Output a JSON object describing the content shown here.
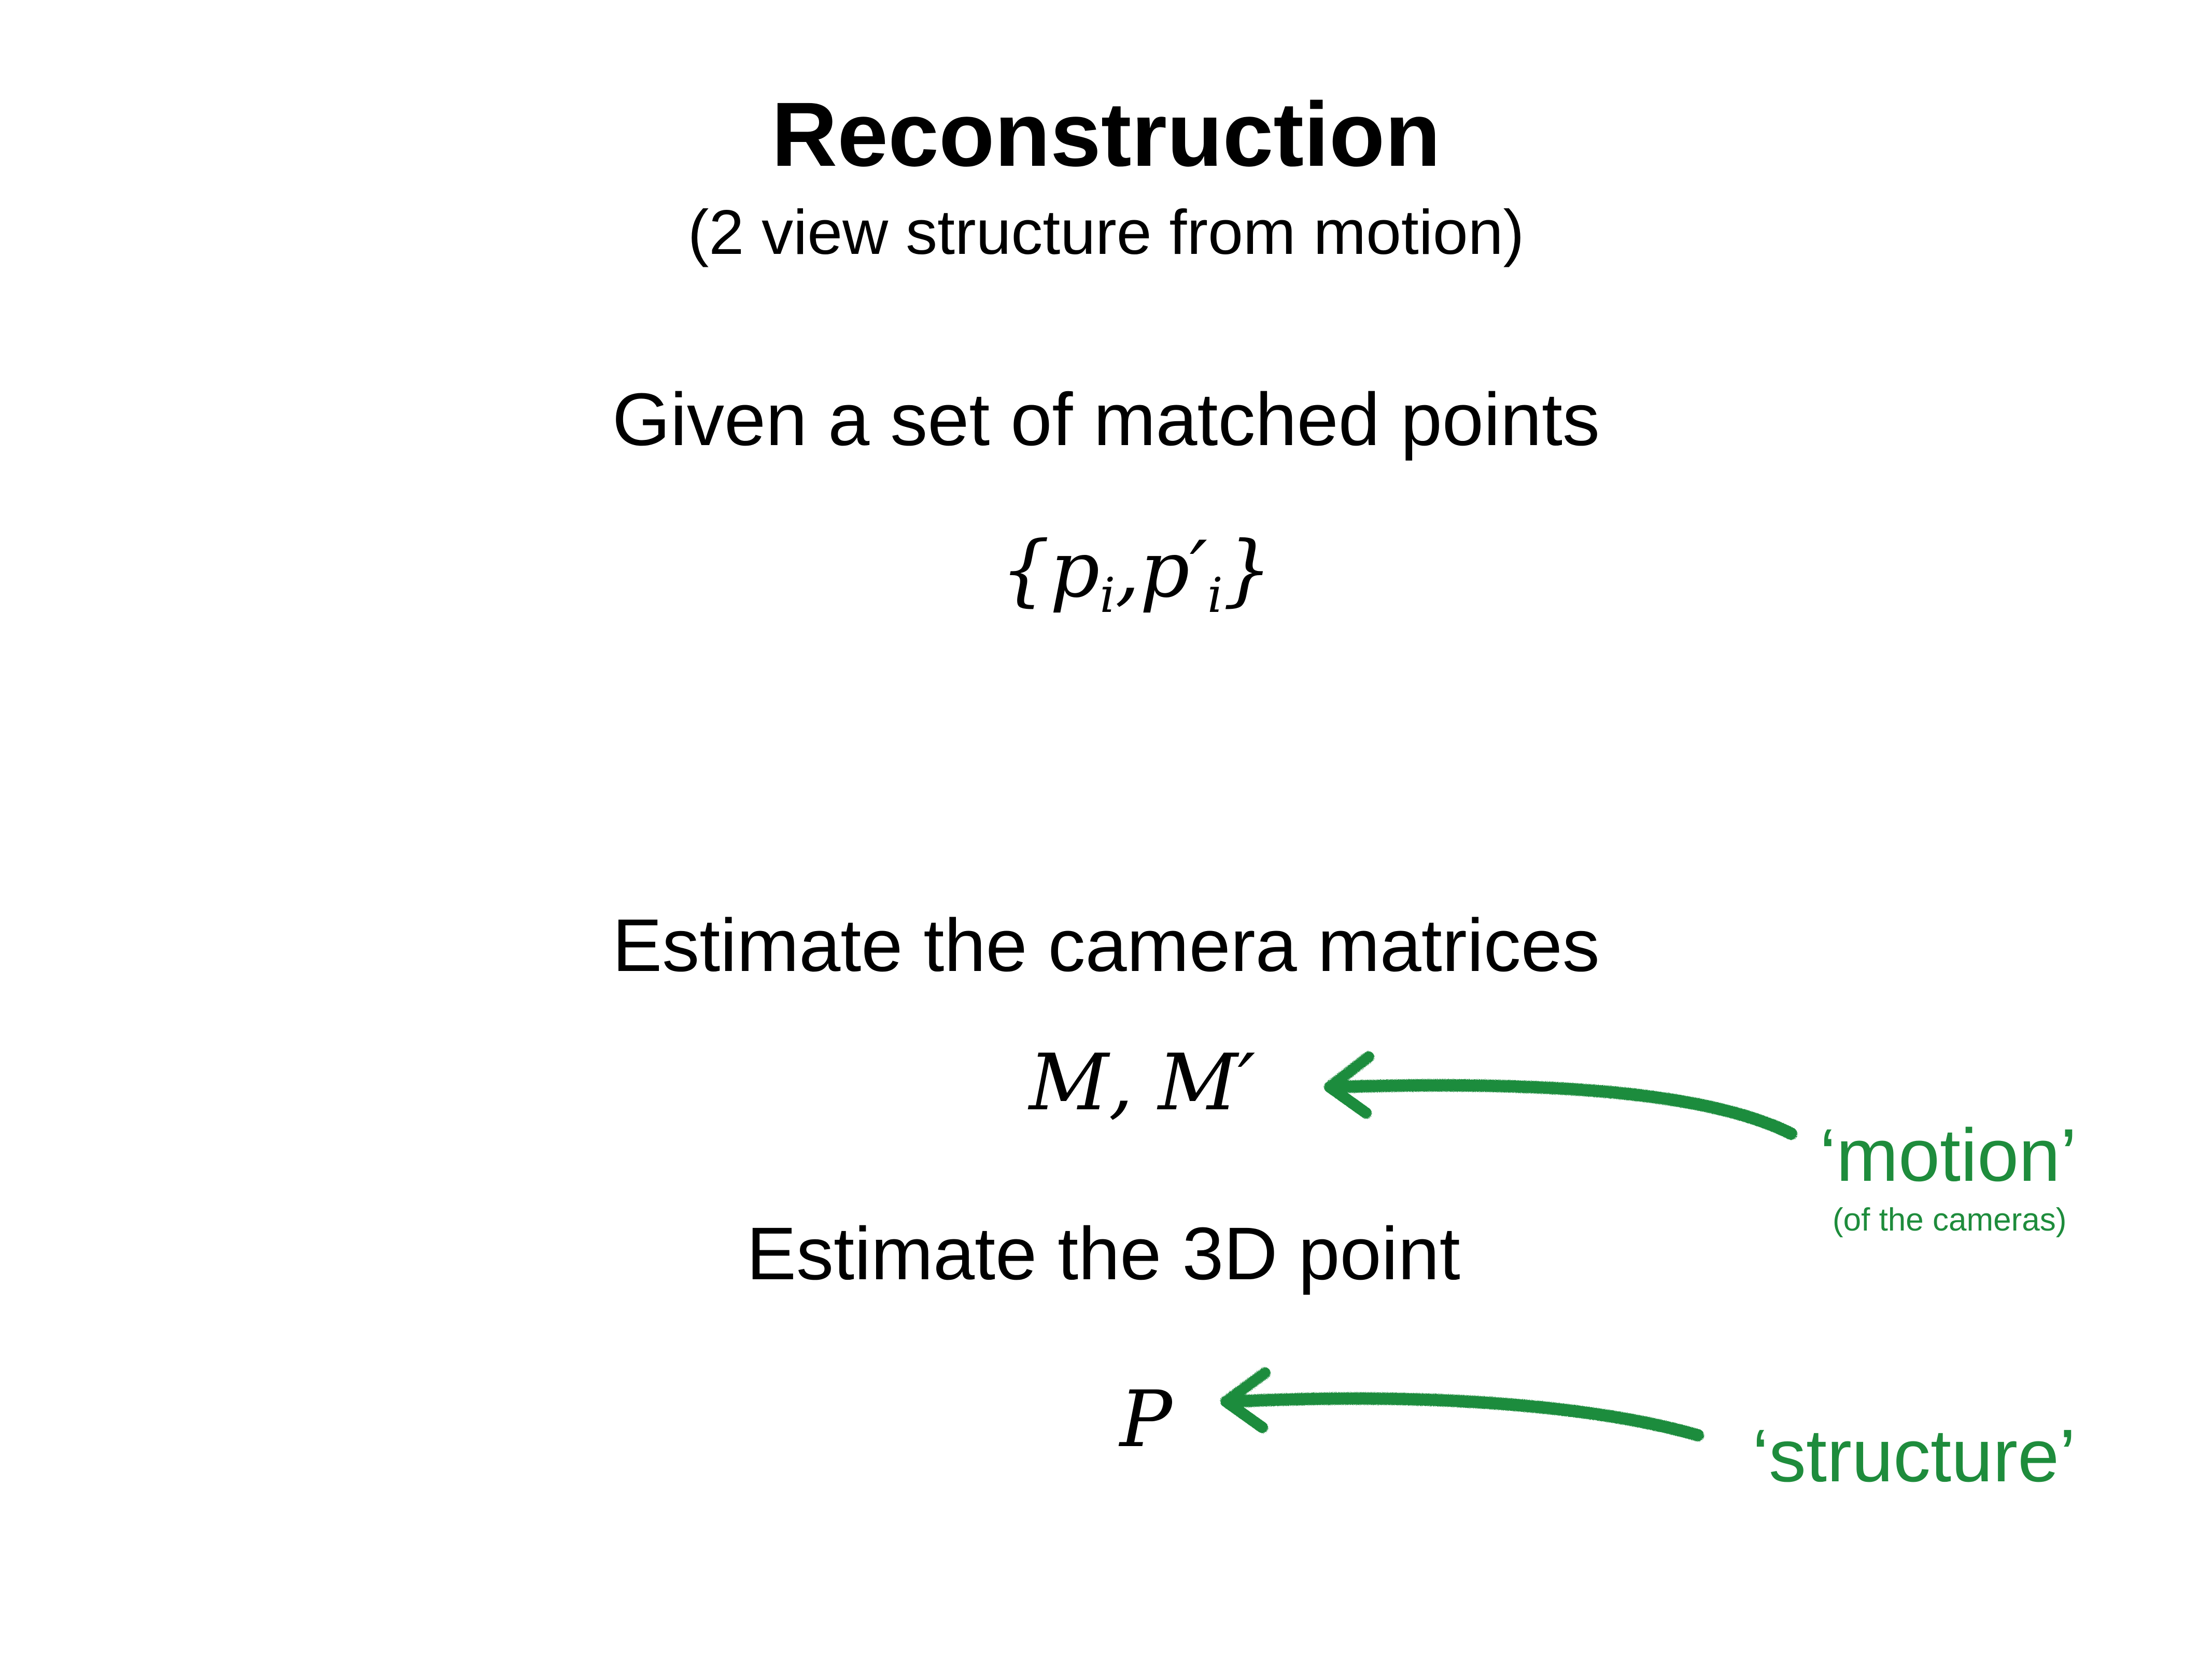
{
  "slide": {
    "title": "Reconstruction",
    "subtitle": "(2 view structure from motion)",
    "given_text": "Given a set of matched points",
    "given_math": {
      "open_brace": "{",
      "p1": "p",
      "sub1": "i",
      "comma": ",",
      "p2": "p",
      "prime": "′",
      "sub2": "i",
      "close_brace": "}"
    },
    "estimate_cameras_text": "Estimate the camera matrices",
    "cameras_math": "M, M′",
    "estimate_point_text": "Estimate the 3D point",
    "point_math": "P",
    "motion_label": "‘motion’",
    "motion_sublabel": "(of the cameras)",
    "structure_label": "‘structure’",
    "accent_color": "#1e8c3c"
  }
}
